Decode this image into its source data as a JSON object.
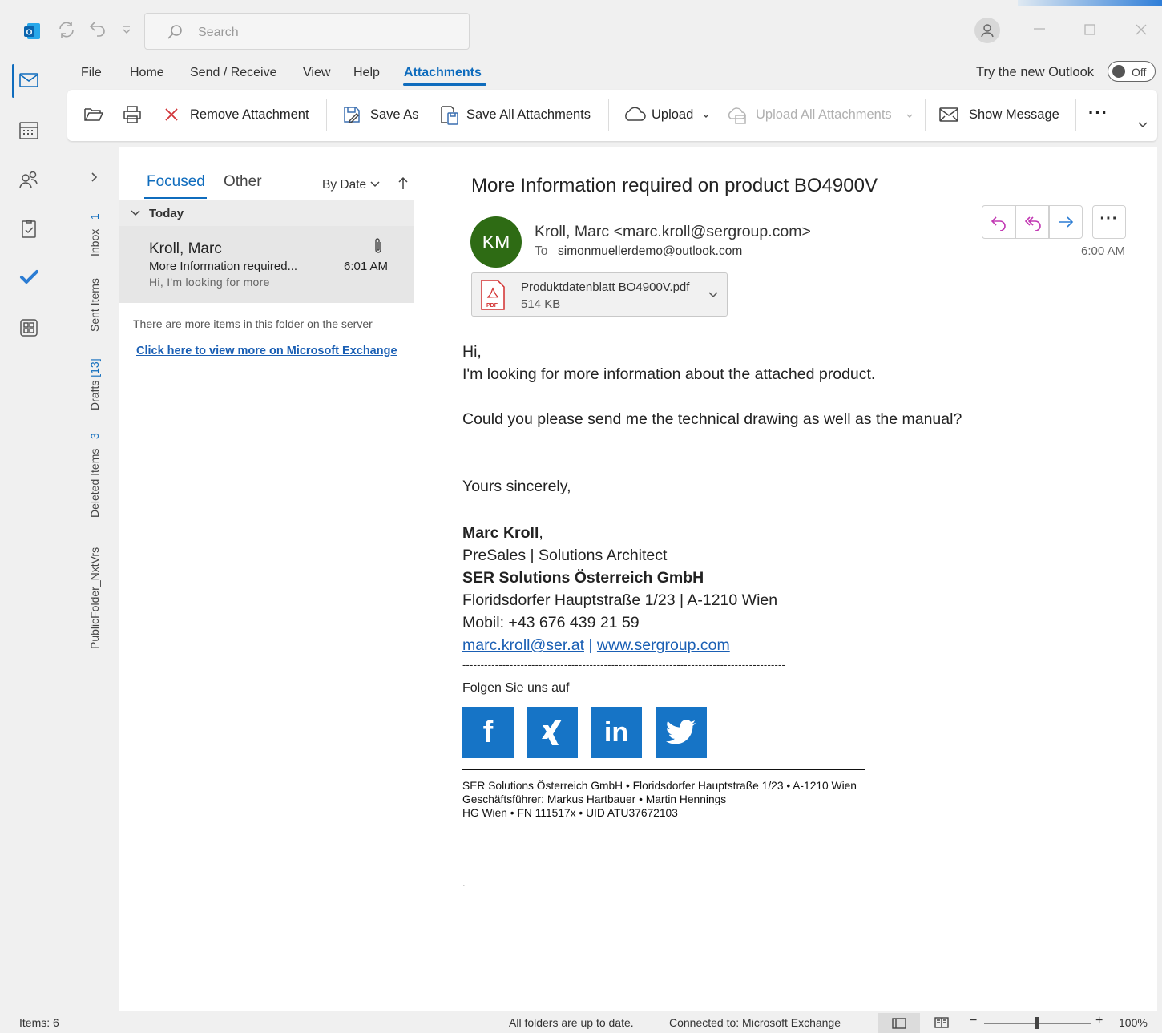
{
  "titlebar": {
    "search_placeholder": "Search"
  },
  "menu": {
    "file": "File",
    "home": "Home",
    "send_receive": "Send / Receive",
    "view": "View",
    "help": "Help",
    "attachments": "Attachments"
  },
  "new_outlook": {
    "label": "Try the new Outlook",
    "toggle": "Off"
  },
  "ribbon": {
    "remove_attachment": "Remove Attachment",
    "save_as": "Save As",
    "save_all": "Save All Attachments",
    "upload": "Upload",
    "upload_all": "Upload All Attachments",
    "show_message": "Show Message",
    "more": "···"
  },
  "folders": {
    "inbox": {
      "label": "Inbox",
      "count": "1"
    },
    "sent": {
      "label": "Sent Items"
    },
    "drafts": {
      "label": "Drafts",
      "count": "[13]"
    },
    "deleted": {
      "label": "Deleted Items",
      "count": "3"
    },
    "public": {
      "label": "PublicFolder_NxtVrs"
    }
  },
  "list": {
    "tab_focused": "Focused",
    "tab_other": "Other",
    "sort": "By Date",
    "group": "Today",
    "message": {
      "sender": "Kroll, Marc",
      "subject": "More Information required...",
      "time": "6:01 AM",
      "preview": "Hi,  I'm looking for more"
    },
    "server_note": "There are more items in this folder on the server",
    "server_link": "Click here to view more on Microsoft Exchange"
  },
  "reading": {
    "subject": "More Information required on product BO4900V",
    "avatar": "KM",
    "from": "Kroll, Marc <marc.kroll@sergroup.com>",
    "to_label": "To",
    "to": "simonmuellerdemo@outlook.com",
    "time": "6:00 AM",
    "attachment": {
      "name": "Produktdatenblatt BO4900V.pdf",
      "size": "514 KB"
    },
    "body": {
      "greeting": "Hi,",
      "line1": "I'm looking for more information about the attached product.",
      "line2": "Could you please send me the technical drawing as well as the manual?",
      "closing": "Yours sincerely,",
      "sig_name": "Marc Kroll",
      "sig_comma": ",",
      "sig_role": "PreSales | Solutions Architect",
      "sig_company": "SER Solutions Österreich GmbH",
      "sig_address": "Floridsdorfer Hauptstraße 1/23 | A-1210 Wien",
      "sig_mobile": "Mobil: +43 676 439 21 59",
      "sig_email": "marc.kroll@ser.at",
      "sig_pipe": "|",
      "sig_web": "www.sergroup.com",
      "dashes": "-----------------------------------------------------------------------------------------",
      "follow": "Folgen Sie uns auf",
      "footer1": "SER Solutions Österreich GmbH • Floridsdorfer Hauptstraße 1/23 • A-1210 Wien",
      "footer2": "Geschäftsführer: Markus Hartbauer • Martin Hennings",
      "footer3": "HG Wien • FN 111517x • UID ATU37672103",
      "dot": "."
    },
    "social": {
      "facebook": "f",
      "xing": "X",
      "linkedin": "in",
      "twitter": "t"
    }
  },
  "status": {
    "items": "Items: 6",
    "sync": "All folders are up to date.",
    "connection": "Connected to: Microsoft Exchange",
    "zoom": "100%"
  },
  "colors": {
    "accent": "#0f6cbd",
    "avatar_bg": "#2e6b14",
    "social": "#1674c6",
    "pdf_red": "#d32f2f"
  }
}
